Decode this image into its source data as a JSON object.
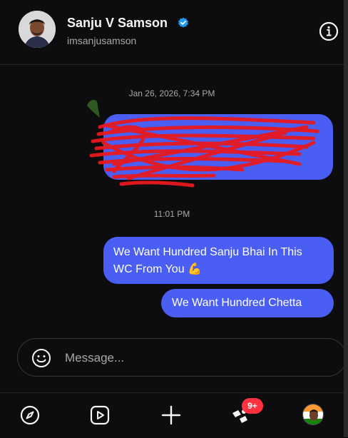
{
  "header": {
    "name": "Sanju V Samson",
    "handle": "imsanjusamson",
    "verified_color": "#1d9bf0"
  },
  "thread": {
    "timestamp_1": "Jan 26, 2026, 7:34 PM",
    "timestamp_2": "11:01 PM",
    "messages": [
      {
        "text": "We Want Hundred Sanju Bhai In This WC From You 💪"
      },
      {
        "text": "We Want Hundred Chetta"
      }
    ]
  },
  "composer": {
    "placeholder": "Message..."
  },
  "nav": {
    "items": [
      "compass-icon",
      "reels-icon",
      "plus-icon",
      "activity-icon",
      "profile-avatar"
    ],
    "badge": "9+"
  },
  "colors": {
    "accent": "#4a5ef3",
    "badge": "#ff3040",
    "background": "#0d0d0f",
    "scribble": "#e8191e"
  }
}
